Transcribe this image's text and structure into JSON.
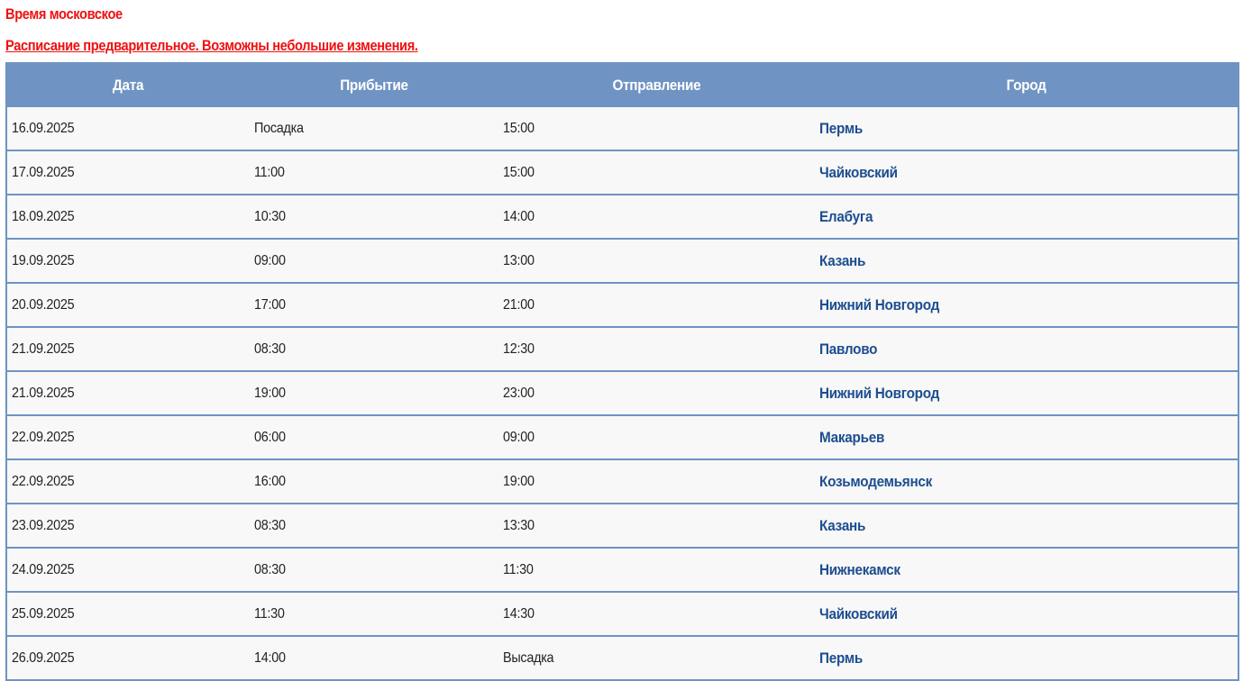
{
  "notices": {
    "time": "Время московское",
    "preliminary": "Расписание предварительное. Возможны небольшие изменения."
  },
  "table": {
    "headers": [
      "Дата",
      "Прибытие",
      "Отправление",
      "Город"
    ],
    "rows": [
      {
        "date": "16.09.2025",
        "arrival": "Посадка",
        "departure": "15:00",
        "city": "Пермь"
      },
      {
        "date": "17.09.2025",
        "arrival": "11:00",
        "departure": "15:00",
        "city": "Чайковский"
      },
      {
        "date": "18.09.2025",
        "arrival": "10:30",
        "departure": "14:00",
        "city": "Елабуга"
      },
      {
        "date": "19.09.2025",
        "arrival": "09:00",
        "departure": "13:00",
        "city": "Казань"
      },
      {
        "date": "20.09.2025",
        "arrival": "17:00",
        "departure": "21:00",
        "city": "Нижний Новгород"
      },
      {
        "date": "21.09.2025",
        "arrival": "08:30",
        "departure": "12:30",
        "city": "Павлово"
      },
      {
        "date": "21.09.2025",
        "arrival": "19:00",
        "departure": "23:00",
        "city": "Нижний Новгород"
      },
      {
        "date": "22.09.2025",
        "arrival": "06:00",
        "departure": "09:00",
        "city": "Макарьев"
      },
      {
        "date": "22.09.2025",
        "arrival": "16:00",
        "departure": "19:00",
        "city": "Козьмодемьянск"
      },
      {
        "date": "23.09.2025",
        "arrival": "08:30",
        "departure": "13:30",
        "city": "Казань"
      },
      {
        "date": "24.09.2025",
        "arrival": "08:30",
        "departure": "11:30",
        "city": "Нижнекамск"
      },
      {
        "date": "25.09.2025",
        "arrival": "11:30",
        "departure": "14:30",
        "city": "Чайковский"
      },
      {
        "date": "26.09.2025",
        "arrival": "14:00",
        "departure": "Высадка",
        "city": "Пермь"
      }
    ]
  },
  "colors": {
    "notice_red": "#ee1111",
    "header_blue": "#6f93c3",
    "city_link_blue": "#1d4e8f",
    "row_background": "#f8f8f8"
  }
}
